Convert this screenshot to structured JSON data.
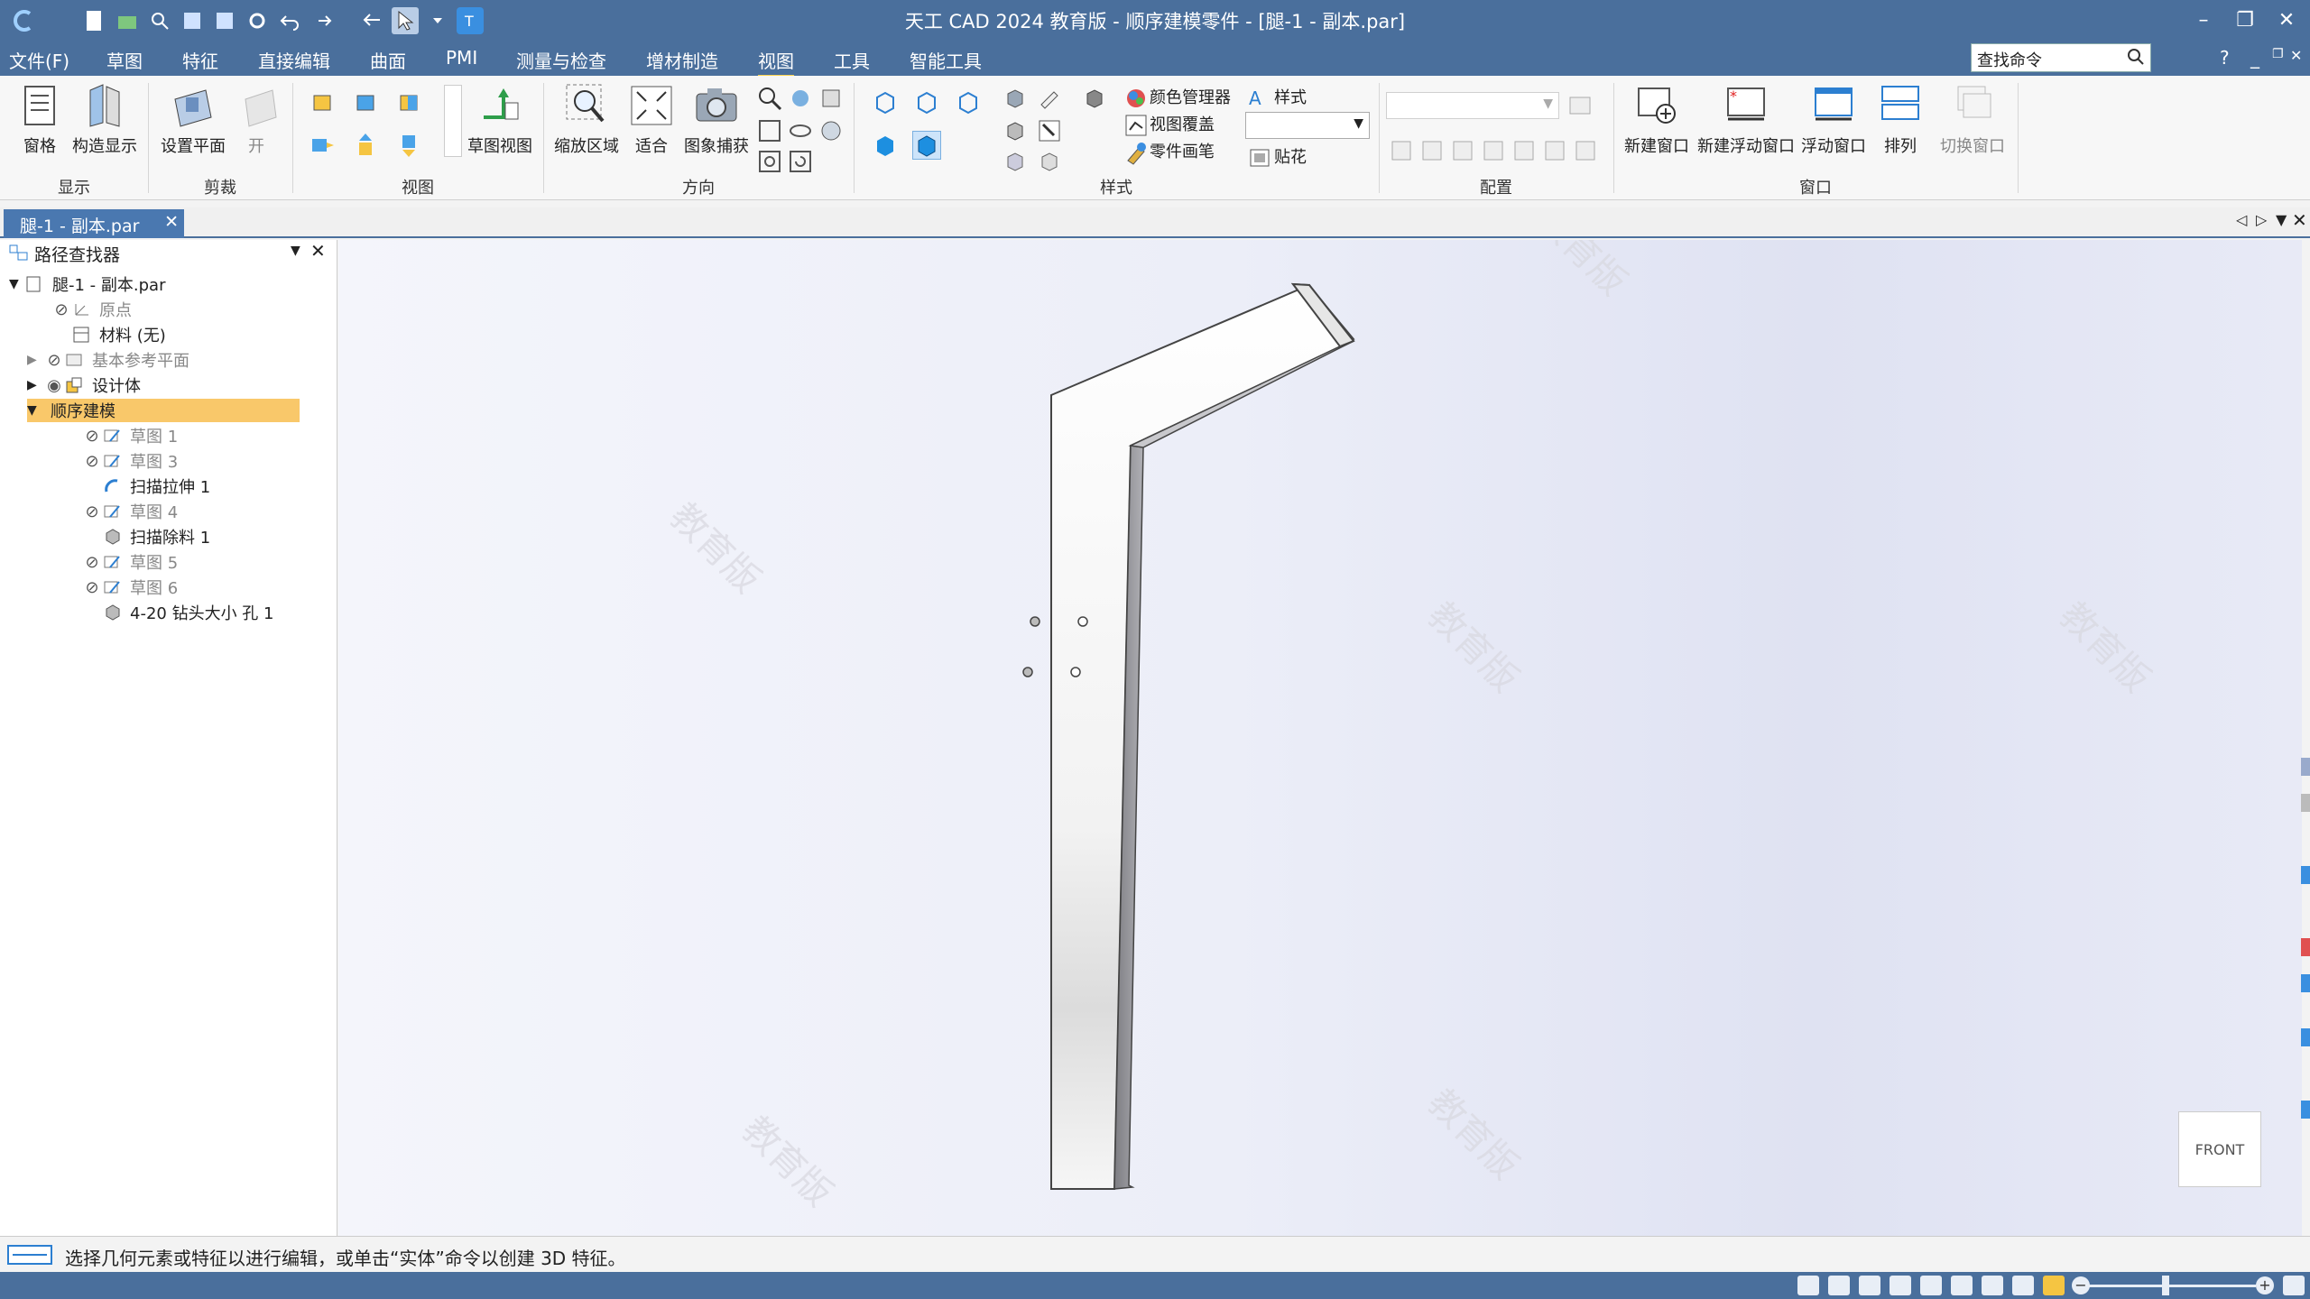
{
  "window": {
    "title": "天工 CAD 2024 教育版 - 顺序建模零件 - [腿-1 - 副本.par]"
  },
  "menu": {
    "items": [
      "文件(F)",
      "草图",
      "特征",
      "直接编辑",
      "曲面",
      "PMI",
      "测量与检查",
      "增材制造",
      "视图",
      "工具",
      "智能工具"
    ],
    "active": "视图",
    "search_placeholder": "查找命令"
  },
  "ribbon": {
    "groups": {
      "display": "显示",
      "clip": "剪裁",
      "views": "视图",
      "orient": "方向",
      "style": "样式",
      "config": "配置",
      "window": "窗口"
    },
    "buttons": {
      "pane": "窗格",
      "construction_display": "构造显示",
      "set_plane": "设置平面",
      "open": "开",
      "sketch_view": "草图视图",
      "zoom_area": "缩放区域",
      "fit": "适合",
      "image_capture": "图象捕获",
      "color_manager": "颜色管理器",
      "view_overlay": "视图覆盖",
      "part_brush": "零件画笔",
      "style": "样式",
      "decal": "贴花",
      "new_window": "新建窗口",
      "new_float_window": "新建浮动窗口",
      "float_window": "浮动窗口",
      "arrange": "排列",
      "switch_window": "切换窗口"
    }
  },
  "doc_tab": {
    "label": "腿-1 - 副本.par"
  },
  "pathfinder": {
    "title": "路径查找器",
    "root": "腿-1 - 副本.par",
    "items": [
      {
        "label": "原点",
        "level": 1,
        "dim": true
      },
      {
        "label": "材料 (无)",
        "level": 1,
        "dim": false
      },
      {
        "label": "基本参考平面",
        "level": 1,
        "dim": true
      },
      {
        "label": "设计体",
        "level": 1,
        "dim": false
      },
      {
        "label": "顺序建模",
        "level": 1,
        "dim": false
      },
      {
        "label": "草图 1",
        "level": 2,
        "dim": true
      },
      {
        "label": "草图 3",
        "level": 2,
        "dim": true
      },
      {
        "label": "扫描拉伸 1",
        "level": 2,
        "dim": false
      },
      {
        "label": "草图 4",
        "level": 2,
        "dim": true
      },
      {
        "label": "扫描除料 1",
        "level": 2,
        "dim": false
      },
      {
        "label": "草图 5",
        "level": 2,
        "dim": true
      },
      {
        "label": "草图 6",
        "level": 2,
        "dim": true
      },
      {
        "label": "4-20 钻头大小 孔 1",
        "level": 2,
        "dim": false
      }
    ]
  },
  "viewport": {
    "watermark": "教育版",
    "view_cube": "FRONT"
  },
  "status": {
    "message": "选择几何元素或特征以进行编辑，或单击“实体”命令以创建 3D 特征。"
  },
  "colors": {
    "title_bar": "#4a6f9c",
    "active_tab": "#4a78b0",
    "highlight": "#f9c86a"
  }
}
